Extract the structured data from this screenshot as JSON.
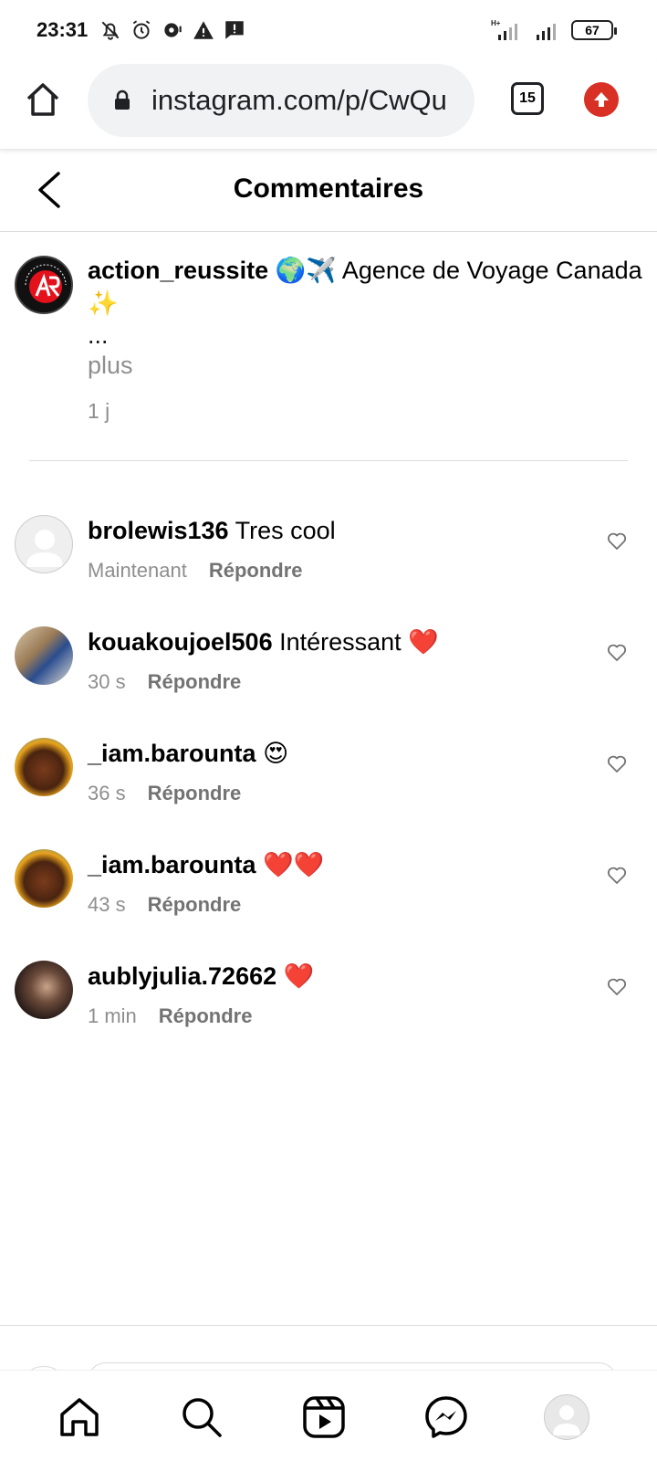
{
  "status_bar": {
    "time": "23:31",
    "network": "H+",
    "battery": "67"
  },
  "browser": {
    "url": "instagram.com/p/CwQu",
    "tab_count": "15",
    "update_color": "#d93025"
  },
  "header": {
    "title": "Commentaires"
  },
  "caption": {
    "username": "action_reussite",
    "text": "🌍✈️ Agence de Voyage Canada ✨",
    "ellipsis": "...",
    "more": "plus",
    "time": "1 j"
  },
  "comments": [
    {
      "username": "brolewis136",
      "text": "Tres cool",
      "time": "Maintenant",
      "reply": "Répondre",
      "avatar": "placeholder"
    },
    {
      "username": "kouakoujoel506",
      "text": "Intéressant ❤️",
      "time": "30 s",
      "reply": "Répondre",
      "avatar": "photo-blue"
    },
    {
      "username": "_iam.barounta",
      "text": "😍",
      "time": "36 s",
      "reply": "Répondre",
      "avatar": "art-portrait"
    },
    {
      "username": "_iam.barounta",
      "text": "❤️❤️",
      "time": "43 s",
      "reply": "Répondre",
      "avatar": "art-portrait"
    },
    {
      "username": "aublyjulia.72662",
      "text": "❤️",
      "time": "1 min",
      "reply": "Répondre",
      "avatar": "photo-dark"
    }
  ],
  "nav": [
    "home-icon",
    "search-icon",
    "reels-icon",
    "messenger-icon",
    "profile-icon"
  ]
}
